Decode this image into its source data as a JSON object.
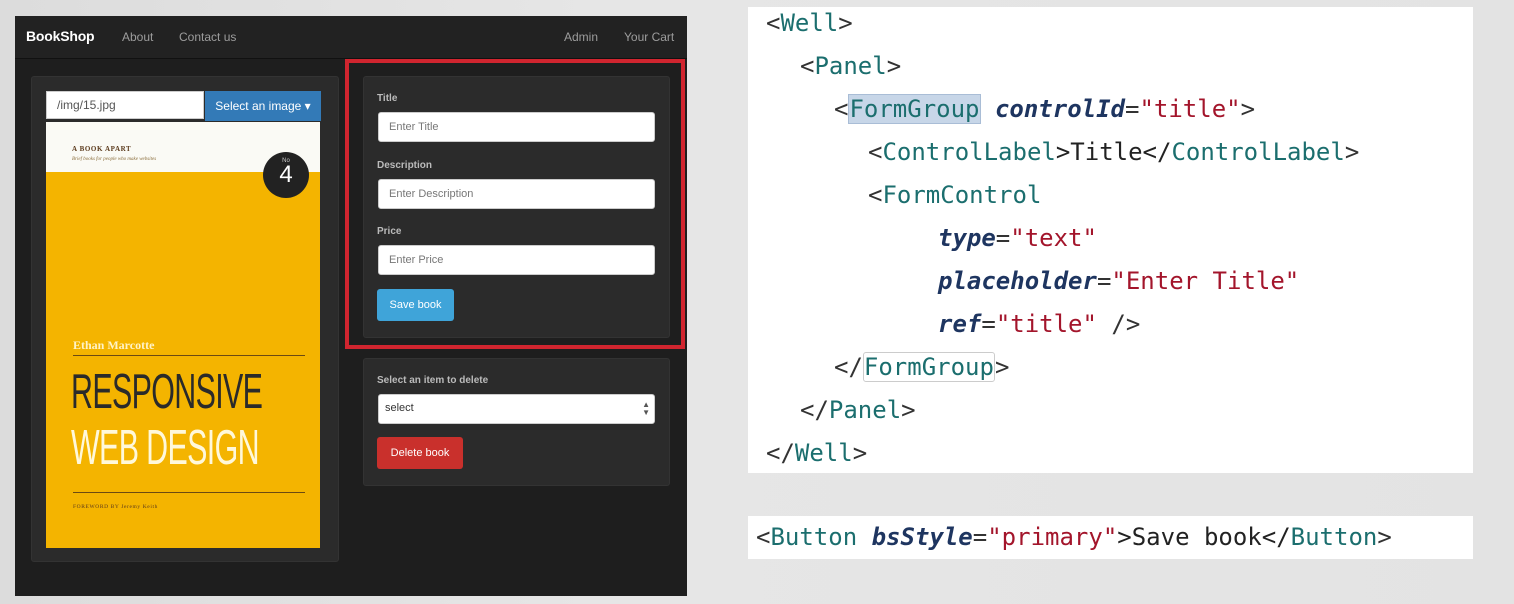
{
  "app": {
    "brand": "BookShop",
    "nav_left": [
      "About",
      "Contact us"
    ],
    "nav_right": [
      "Admin",
      "Your Cart"
    ],
    "image_path": "/img/15.jpg",
    "image_dropdown_label": "Select an image ▾",
    "cover": {
      "publisher": "A BOOK APART",
      "tagline": "Brief books for people who make websites",
      "badge_prefix": "No",
      "badge_number": "4",
      "author": "Ethan Marcotte",
      "title_line1": "RESPONSIVE",
      "title_line2": "WEB DESIGN",
      "foreword": "FOREWORD BY Jeremy Keith"
    },
    "form": {
      "title_label": "Title",
      "title_placeholder": "Enter Title",
      "description_label": "Description",
      "description_placeholder": "Enter Description",
      "price_label": "Price",
      "price_placeholder": "Enter Price",
      "save_label": "Save book"
    },
    "delete": {
      "label": "Select an item to delete",
      "select_value": "select",
      "delete_label": "Delete book"
    },
    "colors": {
      "highlight": "#d0252f",
      "primary": "#3fa4d9",
      "danger": "#c9302c",
      "dropdown": "#337ab7"
    }
  },
  "code": {
    "l1_open": "<",
    "l1_tag": "Well",
    "l1_close": ">",
    "l2_open": "<",
    "l2_tag": "Panel",
    "l2_close": ">",
    "l3_open": "<",
    "l3_tag": "FormGroup",
    "l3_attr": "controlId",
    "l3_eq": "=",
    "l3_val": "\"title\"",
    "l3_close": ">",
    "l4_open": "<",
    "l4_tag": "ControlLabel",
    "l4_mid": ">Title</",
    "l4_tag2": "ControlLabel",
    "l4_close": ">",
    "l5_open": "<",
    "l5_tag": "FormControl",
    "l6_attr": "type",
    "l6_eq": "=",
    "l6_val": "\"text\"",
    "l7_attr": "placeholder",
    "l7_eq": "=",
    "l7_val": "\"Enter Title\"",
    "l8_attr": "ref",
    "l8_eq": "=",
    "l8_val": "\"title\"",
    "l8_end": " />",
    "l9_open": "</",
    "l9_tag": "FormGroup",
    "l9_close": ">",
    "l10_open": "</",
    "l10_tag": "Panel",
    "l10_close": ">",
    "l11_open": "</",
    "l11_tag": "Well",
    "l11_close": ">",
    "b_open": "<",
    "b_tag": "Button",
    "b_attr": "bsStyle",
    "b_eq": "=",
    "b_val": "\"primary\"",
    "b_mid": ">Save book</",
    "b_tag2": "Button",
    "b_close": ">"
  }
}
